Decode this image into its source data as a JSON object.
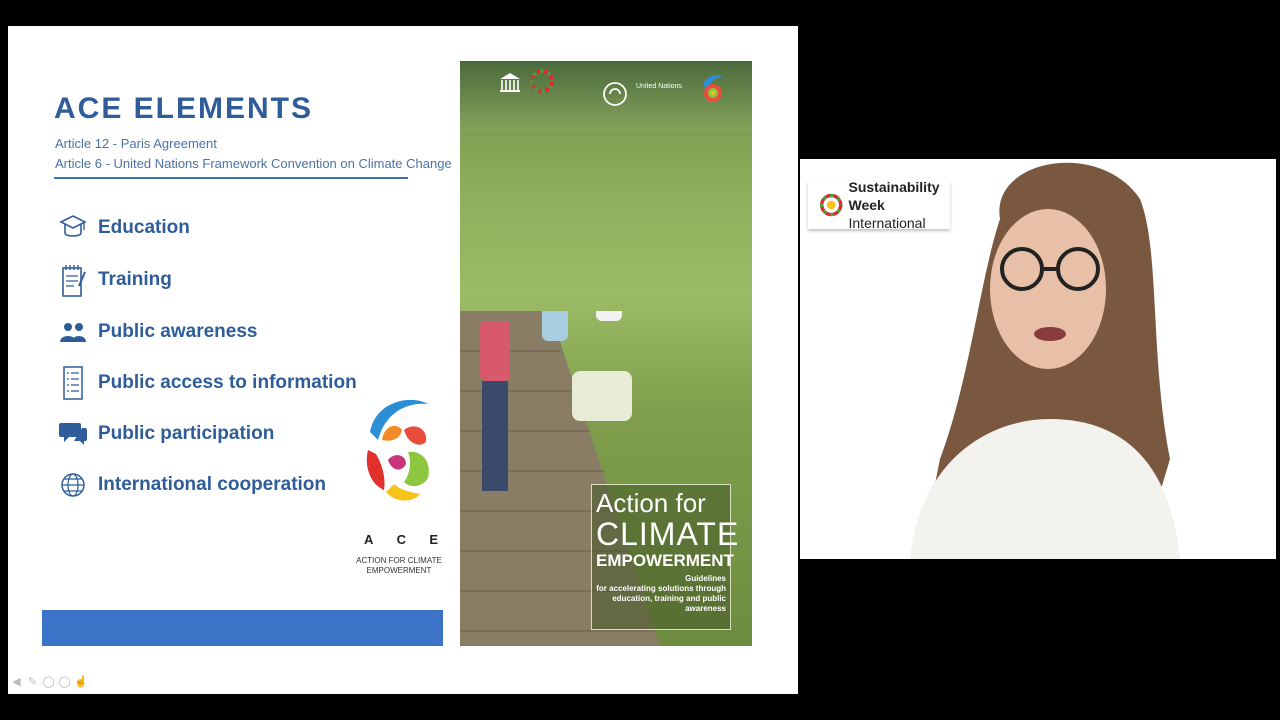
{
  "slide": {
    "title": "ACE ELEMENTS",
    "subtitle_1": "Article 12 - Paris Agreement",
    "subtitle_2": "Article 6 - United Nations Framework Convention on Climate Change",
    "elements": [
      {
        "label": "Education",
        "icon": "graduation-cap-icon"
      },
      {
        "label": "Training",
        "icon": "notepad-icon"
      },
      {
        "label": "Public awareness",
        "icon": "people-icon"
      },
      {
        "label": "Public access to information",
        "icon": "document-list-icon"
      },
      {
        "label": "Public participation",
        "icon": "speech-bubbles-icon"
      },
      {
        "label": "International cooperation",
        "icon": "globe-icon"
      }
    ],
    "ace_logo": {
      "letters": [
        "A",
        "C",
        "E"
      ],
      "subtitle_1": "ACTION FOR CLIMATE",
      "subtitle_2": "EMPOWERMENT"
    },
    "cover": {
      "un_text": "United Nations",
      "title_1": "Action for",
      "title_2": "CLIMATE",
      "title_3": "EMPOWERMENT",
      "guidelines_1": "Guidelines",
      "guidelines_2": "for accelerating solutions through",
      "guidelines_3": "education, training and public awareness"
    }
  },
  "presenter": {
    "badge_line_1": "Sustainability",
    "badge_line_2_bold": "Week",
    "badge_line_2_rest": " International"
  },
  "colors": {
    "title_blue": "#2f5d9a",
    "bar_blue": "#3b73c6",
    "background": "#000000"
  }
}
